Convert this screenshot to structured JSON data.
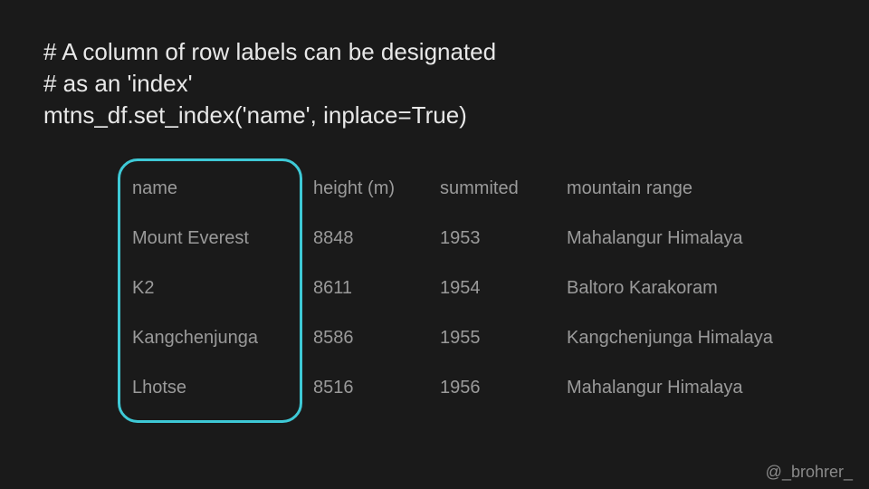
{
  "code": {
    "line1": "# A column of row labels can be designated",
    "line2": "# as an 'index'",
    "line3": "mtns_df.set_index('name', inplace=True)"
  },
  "table": {
    "headers": {
      "name": "name",
      "height": "height (m)",
      "summited": "summited",
      "range": "mountain range"
    },
    "rows": [
      {
        "name": "Mount Everest",
        "height": "8848",
        "summited": "1953",
        "range": "Mahalangur Himalaya"
      },
      {
        "name": "K2",
        "height": "8611",
        "summited": "1954",
        "range": "Baltoro Karakoram"
      },
      {
        "name": "Kangchenjunga",
        "height": "8586",
        "summited": "1955",
        "range": "Kangchenjunga Himalaya"
      },
      {
        "name": "Lhotse",
        "height": "8516",
        "summited": "1956",
        "range": "Mahalangur Himalaya"
      }
    ]
  },
  "attribution": "@_brohrer_"
}
